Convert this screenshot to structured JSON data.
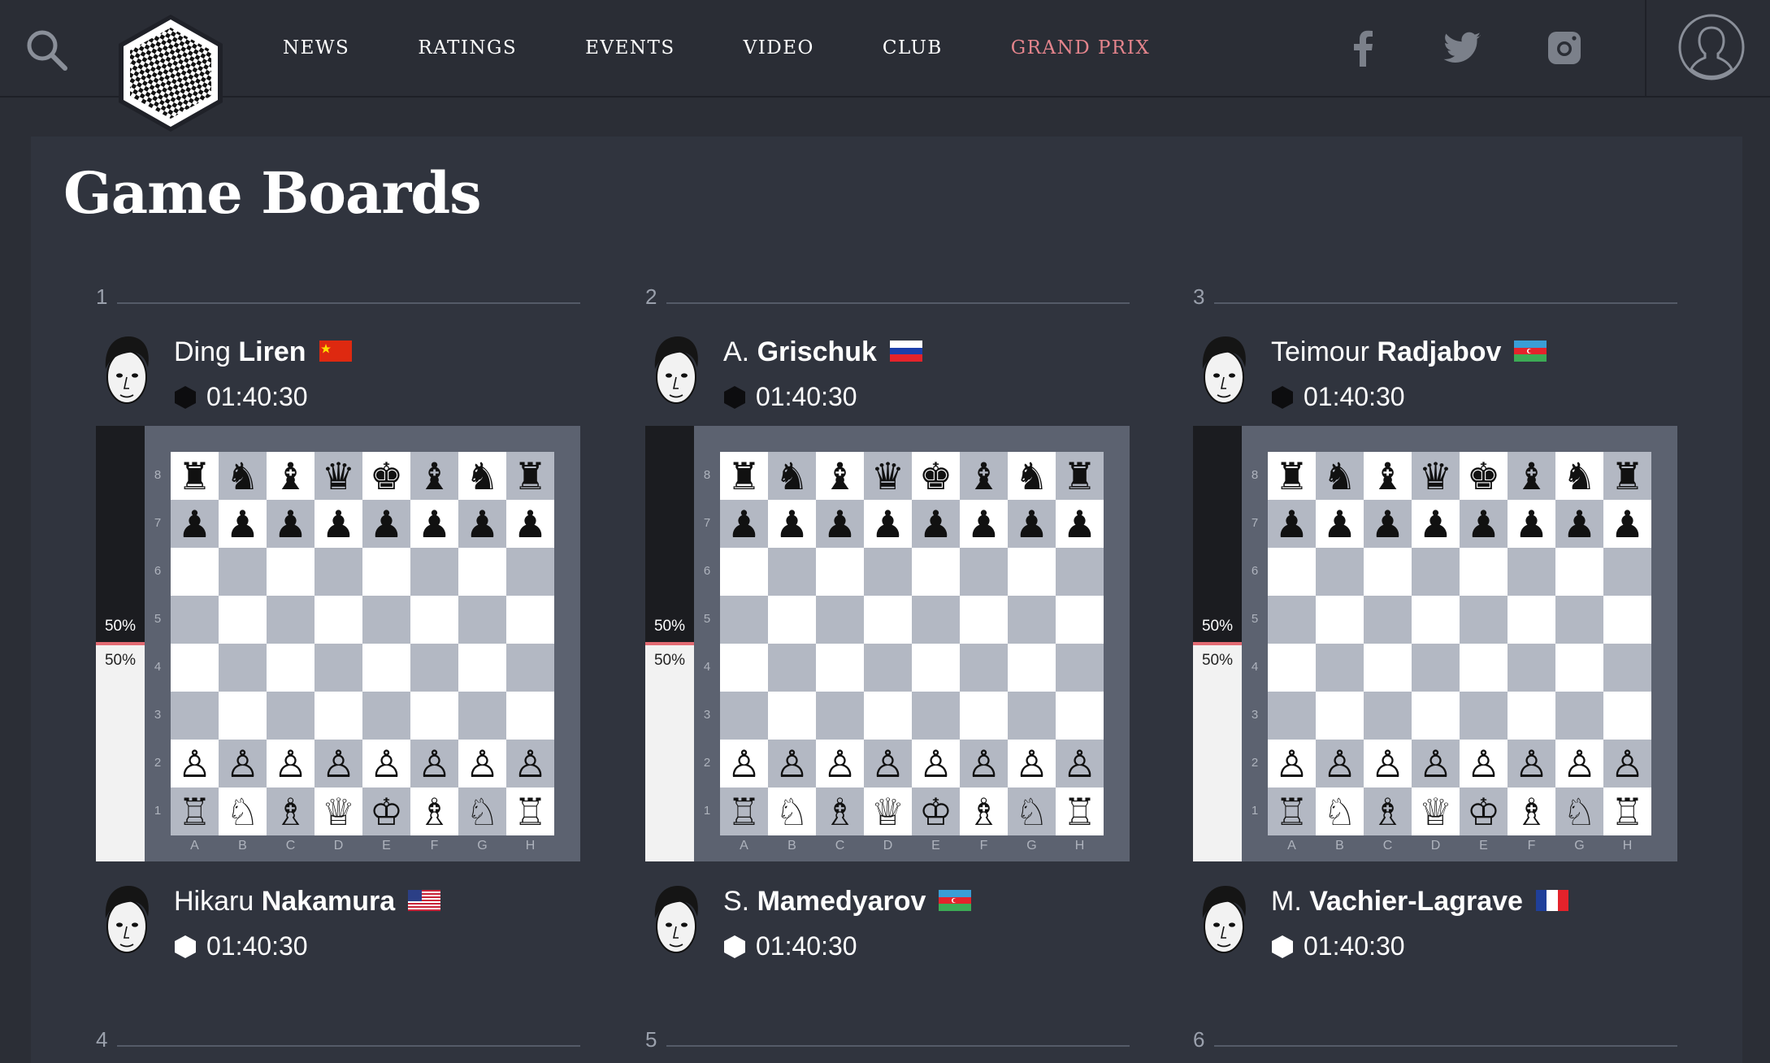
{
  "nav": {
    "items": [
      "NEWS",
      "RATINGS",
      "EVENTS",
      "VIDEO",
      "CLUB",
      "GRAND PRIX"
    ],
    "active": "GRAND PRIX"
  },
  "page_title": "Game Boards",
  "files": [
    "A",
    "B",
    "C",
    "D",
    "E",
    "F",
    "G",
    "H"
  ],
  "ranks": [
    "8",
    "7",
    "6",
    "5",
    "4",
    "3",
    "2",
    "1"
  ],
  "colors": {
    "accent": "#e4848c",
    "background": "#2b2e36",
    "panel": "#30343e",
    "light_square": "#ffffff",
    "dark_square": "#b3b8c3"
  },
  "games": [
    {
      "number": "1",
      "black": {
        "first": "Ding",
        "last": "Liren",
        "flag": "china",
        "clock": "01:40:30"
      },
      "white": {
        "first": "Hikaru",
        "last": "Nakamura",
        "flag": "usa",
        "clock": "01:40:30"
      },
      "eval_black": "50%",
      "eval_white": "50%",
      "eval_black_fraction": 0.5
    },
    {
      "number": "2",
      "black": {
        "first": "A.",
        "last": "Grischuk",
        "flag": "russia",
        "clock": "01:40:30"
      },
      "white": {
        "first": "S.",
        "last": "Mamedyarov",
        "flag": "azerbaijan",
        "clock": "01:40:30"
      },
      "eval_black": "50%",
      "eval_white": "50%",
      "eval_black_fraction": 0.5
    },
    {
      "number": "3",
      "black": {
        "first": "Teimour",
        "last": "Radjabov",
        "flag": "azerbaijan",
        "clock": "01:40:30"
      },
      "white": {
        "first": "M.",
        "last": "Vachier-Lagrave",
        "flag": "france",
        "clock": "01:40:30"
      },
      "eval_black": "50%",
      "eval_white": "50%",
      "eval_black_fraction": 0.5
    }
  ],
  "next_games": [
    "4",
    "5",
    "6"
  ],
  "board_position": [
    "rnbqkbnr",
    "pppppppp",
    "........",
    "........",
    "........",
    "........",
    "PPPPPPPP",
    "RNBQKBNR"
  ],
  "icons": {
    "search": "search-icon",
    "logo": "site-logo",
    "facebook": "facebook-icon",
    "twitter": "twitter-icon",
    "instagram": "instagram-icon",
    "account": "user-avatar-icon"
  }
}
